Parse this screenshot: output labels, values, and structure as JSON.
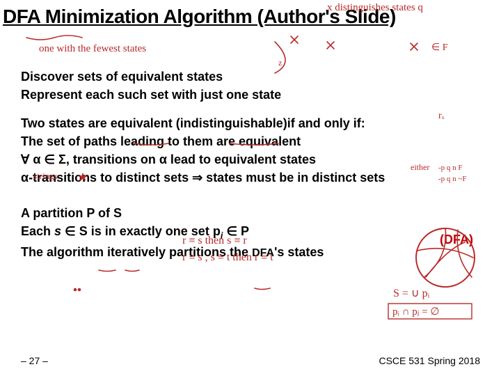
{
  "title": "DFA Minimization Algorithm (Author's Slide)",
  "block1": {
    "l1": "Discover sets of equivalent states",
    "l2": "Represent each such set with just one state"
  },
  "block2": {
    "l1": "Two states are equivalent (indistinguishable)if and only if:",
    "l2": "The set of paths leading to them are equivalent",
    "l3a": "∀ α ∈ Σ, transitions on α lead to equivalent states",
    "dfa": "(DFA)",
    "l4a": "α-transitions to distinct sets ⇒ states must be in distinct sets"
  },
  "block3": {
    "l1": "A partition P of S",
    "l2a": "Each ",
    "l2b": "s",
    "l2c": " ∈ S is in exactly one set p",
    "l2d": "i",
    "l2e": " ∈ P",
    "l3a": "The algorithm iteratively partitions the ",
    "l3b": "DFA",
    "l3c": "'s states"
  },
  "footer": {
    "page": "– 27 –",
    "course": "CSCE 531 Spring 2018"
  },
  "ink": {
    "color": "#b82a2a",
    "top_annot": "x  distinguishes states q",
    "top_annot2": "one with the fewest states",
    "rs": "r ≡ s   then   s ≡ r",
    "rst": "r ≡ s , s ≡ t  then  r ≡ t",
    "union": "S = ∪ pᵢ",
    "inter": "pᵢ ∩ pⱼ = ∅",
    "strings": "strings",
    "either": "either",
    "pqnF": "-p q n F",
    "pgnF2": "-p q n ~F",
    "circles": "partition-diagram"
  }
}
